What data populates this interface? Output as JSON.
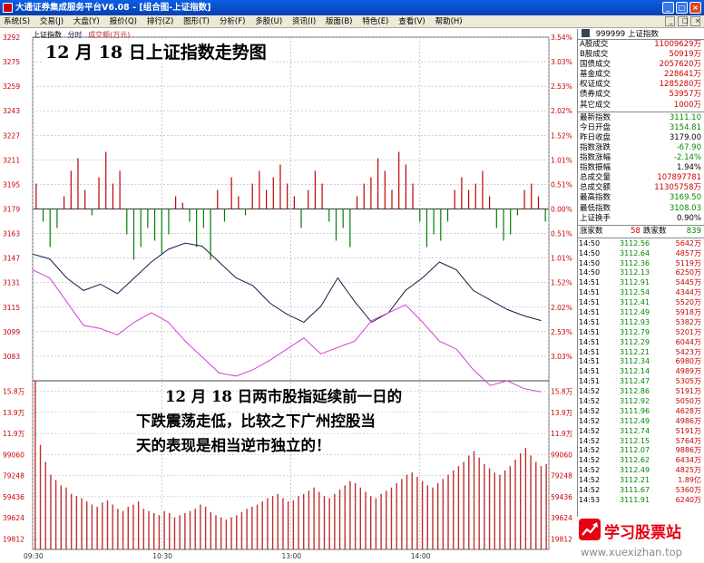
{
  "window": {
    "title": "大通证券集成服务平台V6.08 - [组合图-上证指数]",
    "controls": [
      "_",
      "□",
      "×"
    ]
  },
  "menu": {
    "items": [
      "系统(S)",
      "交易(J)",
      "大盘(Y)",
      "报价(Q)",
      "排行(Z)",
      "图形(T)",
      "分析(F)",
      "多股(U)",
      "资讯(I)",
      "版面(B)",
      "特色(E)",
      "查看(V)",
      "帮助(H)"
    ],
    "doc_controls": [
      "_",
      "□",
      "×"
    ]
  },
  "chart_header": {
    "index_label": "上证指数",
    "mode_label": "分时",
    "volume_label": "成交额(万元)"
  },
  "overlay_title": "12 月 18 日上证指数走势图",
  "commentary": [
    "12 月 18 日两市股指延续前一日的",
    "下跌震荡走低，比较之下广州控股当",
    "天的表现是相当逆市独立的！"
  ],
  "chart_data": [
    {
      "type": "line",
      "title": "上证指数",
      "ylabel_left": [
        "3292",
        "3275",
        "3259",
        "3243",
        "3227",
        "3211",
        "3195",
        "3179",
        "3163",
        "3147",
        "3131",
        "3115",
        "3099",
        "3083"
      ],
      "ylabel_right": [
        "3.54%",
        "3.03%",
        "2.53%",
        "2.02%",
        "1.52%",
        "1.01%",
        "0.51%",
        "0.00%",
        "0.51%",
        "1.01%",
        "1.52%",
        "2.02%",
        "2.53%",
        "3.03%"
      ],
      "prev_close": 3179.0,
      "ylim": [
        3075,
        3292
      ],
      "x_ticks": [
        "09:30",
        "10:30",
        "13:00",
        "14:00"
      ],
      "series": [
        {
          "name": "上证指数",
          "color": "#1a1a4a",
          "values": [
            3155,
            3152,
            3140,
            3132,
            3136,
            3130,
            3140,
            3150,
            3158,
            3162,
            3160,
            3150,
            3140,
            3135,
            3124,
            3117,
            3112,
            3122,
            3140,
            3125,
            3112,
            3118,
            3132,
            3140,
            3150,
            3145,
            3132,
            3126,
            3120,
            3116,
            3113
          ]
        },
        {
          "name": "不含加权",
          "color": "#d040d0",
          "values": [
            3145,
            3140,
            3125,
            3110,
            3108,
            3104,
            3112,
            3118,
            3112,
            3100,
            3090,
            3080,
            3078,
            3082,
            3088,
            3095,
            3102,
            3092,
            3096,
            3100,
            3113,
            3118,
            3123,
            3112,
            3100,
            3095,
            3082,
            3072,
            3075,
            3070,
            3068
          ]
        }
      ],
      "ratio_bars": [
        4,
        -2,
        -6,
        -3,
        2,
        6,
        8,
        3,
        -1,
        5,
        9,
        4,
        6,
        -4,
        -8,
        -6,
        -3,
        -5,
        -7,
        -4,
        2,
        1,
        -2,
        -6,
        -3,
        -8,
        3,
        -2,
        5,
        2,
        -1,
        4,
        6,
        3,
        5,
        7,
        4,
        2,
        -3,
        3,
        6,
        4,
        -2,
        -5,
        -3,
        -6,
        2,
        4,
        5,
        8,
        6,
        3,
        9,
        7,
        4,
        -2,
        -6,
        -4,
        -5,
        -2,
        3,
        5,
        3,
        4,
        6,
        2,
        -3,
        -5,
        -4,
        -1,
        3,
        4,
        2,
        -2
      ]
    },
    {
      "type": "bar",
      "title": "成交额(万元)",
      "ylabel_left": [
        "15.8万",
        "13.9万",
        "11.9万",
        "99060",
        "79248",
        "59436",
        "39624",
        "19812"
      ],
      "ylabel_right": [
        "15.8万",
        "13.9万",
        "11.9万",
        "99060",
        "79248",
        "59436",
        "39624",
        "19812"
      ],
      "ylim": [
        0,
        158000
      ],
      "values": [
        158000,
        98000,
        82000,
        70000,
        65000,
        60000,
        58000,
        52000,
        50000,
        48000,
        45000,
        42000,
        40000,
        44000,
        46000,
        42000,
        38000,
        36000,
        40000,
        42000,
        45000,
        38000,
        36000,
        34000,
        32000,
        36000,
        34000,
        30000,
        32000,
        34000,
        36000,
        38000,
        42000,
        40000,
        35000,
        32000,
        30000,
        28000,
        30000,
        32000,
        35000,
        38000,
        40000,
        42000,
        45000,
        48000,
        50000,
        52000,
        48000,
        45000,
        46000,
        50000,
        52000,
        55000,
        58000,
        54000,
        50000,
        48000,
        52000,
        56000,
        60000,
        64000,
        62000,
        58000,
        54000,
        50000,
        48000,
        52000,
        55000,
        58000,
        62000,
        66000,
        70000,
        72000,
        68000,
        64000,
        60000,
        58000,
        62000,
        66000,
        70000,
        74000,
        78000,
        82000,
        88000,
        92000,
        86000,
        80000,
        76000,
        72000,
        70000,
        74000,
        78000,
        84000,
        90000,
        95000,
        88000,
        82000,
        78000,
        80000
      ]
    }
  ],
  "quote_panel": {
    "code": "999999",
    "name": "上证指数",
    "rows": [
      {
        "label": "A股成交",
        "value": "11009629万",
        "cls": "red"
      },
      {
        "label": "B股成交",
        "value": "50919万",
        "cls": "red"
      },
      {
        "label": "国债成交",
        "value": "2057620万",
        "cls": "red"
      },
      {
        "label": "基金成交",
        "value": "228641万",
        "cls": "red"
      },
      {
        "label": "权证成交",
        "value": "1285280万",
        "cls": "red"
      },
      {
        "label": "债券成交",
        "value": "53957万",
        "cls": "red"
      },
      {
        "label": "其它成交",
        "value": "1000万",
        "cls": "red"
      }
    ],
    "stats": [
      {
        "label": "最新指数",
        "value": "3111.10",
        "cls": "green"
      },
      {
        "label": "今日开盘",
        "value": "3154.81",
        "cls": "green"
      },
      {
        "label": "昨日收盘",
        "value": "3179.00",
        "cls": ""
      },
      {
        "label": "指数涨跌",
        "value": "-67.90",
        "cls": "green"
      },
      {
        "label": "指数涨幅",
        "value": "-2.14%",
        "cls": "green"
      },
      {
        "label": "指数振幅",
        "value": "1.94%",
        "cls": ""
      },
      {
        "label": "总成交量",
        "value": "107897781",
        "cls": "red"
      },
      {
        "label": "总成交额",
        "value": "11305758万",
        "cls": "red"
      },
      {
        "label": "最高指数",
        "value": "3169.50",
        "cls": "green"
      },
      {
        "label": "最低指数",
        "value": "3108.03",
        "cls": "green"
      },
      {
        "label": "上证换手",
        "value": "0.90%",
        "cls": ""
      }
    ],
    "updown": {
      "up_label": "涨家数",
      "up_value": "58",
      "down_label": "跌家数",
      "down_value": "839"
    },
    "trades": [
      {
        "time": "14:50",
        "price": "3112.56",
        "vol": "5642万"
      },
      {
        "time": "14:50",
        "price": "3112.64",
        "vol": "4857万"
      },
      {
        "time": "14:50",
        "price": "3112.36",
        "vol": "5119万"
      },
      {
        "time": "14:50",
        "price": "3112.13",
        "vol": "6250万"
      },
      {
        "time": "14:51",
        "price": "3112.91",
        "vol": "5445万"
      },
      {
        "time": "14:51",
        "price": "3112.54",
        "vol": "4344万"
      },
      {
        "time": "14:51",
        "price": "3112.41",
        "vol": "5520万"
      },
      {
        "time": "14:51",
        "price": "3112.49",
        "vol": "5918万"
      },
      {
        "time": "14:51",
        "price": "3112.93",
        "vol": "5382万"
      },
      {
        "time": "14:51",
        "price": "3112.79",
        "vol": "5201万"
      },
      {
        "time": "14:51",
        "price": "3112.29",
        "vol": "6044万"
      },
      {
        "time": "14:51",
        "price": "3112.21",
        "vol": "5423万"
      },
      {
        "time": "14:51",
        "price": "3112.34",
        "vol": "6980万"
      },
      {
        "time": "14:51",
        "price": "3112.14",
        "vol": "4989万"
      },
      {
        "time": "14:51",
        "price": "3112.47",
        "vol": "5305万"
      },
      {
        "time": "14:52",
        "price": "3112.86",
        "vol": "5191万"
      },
      {
        "time": "14:52",
        "price": "3112.92",
        "vol": "5050万"
      },
      {
        "time": "14:52",
        "price": "3111.96",
        "vol": "4628万"
      },
      {
        "time": "14:52",
        "price": "3112.49",
        "vol": "4986万"
      },
      {
        "time": "14:52",
        "price": "3112.74",
        "vol": "5191万"
      },
      {
        "time": "14:52",
        "price": "3112.15",
        "vol": "5764万"
      },
      {
        "time": "14:52",
        "price": "3112.07",
        "vol": "9886万"
      },
      {
        "time": "14:52",
        "price": "3112.62",
        "vol": "6434万"
      },
      {
        "time": "14:52",
        "price": "3112.49",
        "vol": "4825万"
      },
      {
        "time": "14:52",
        "price": "3112.21",
        "vol": "1.89亿"
      },
      {
        "time": "14:52",
        "price": "3111.67",
        "vol": "5360万"
      },
      {
        "time": "14:53",
        "price": "3111.91",
        "vol": "6240万"
      }
    ]
  },
  "watermark": {
    "title": "学习股票站",
    "url": "www.xuexizhan.top"
  },
  "colors": {
    "up": "#c00000",
    "down": "#008000",
    "grid": "#b0b0c0",
    "index_line": "#1a1a4a",
    "avg_line": "#d040d0",
    "volume_bar": "#c03030"
  }
}
